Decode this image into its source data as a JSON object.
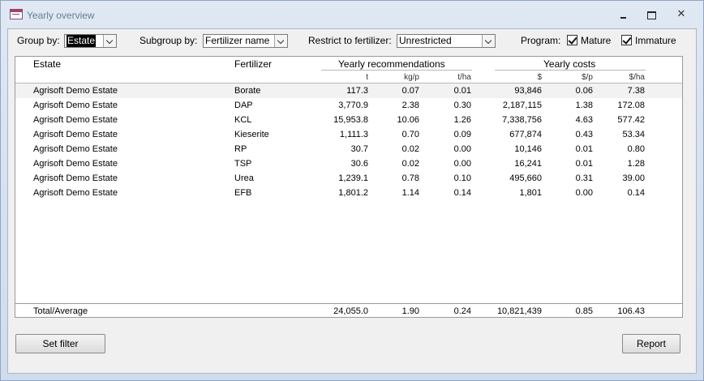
{
  "window": {
    "title": "Yearly overview"
  },
  "filters": {
    "group_by_label": "Group by:",
    "group_by_value": "Estate",
    "subgroup_by_label": "Subgroup by:",
    "subgroup_by_value": "Fertilizer name",
    "restrict_label": "Restrict to fertilizer:",
    "restrict_value": "Unrestricted",
    "program_label": "Program:",
    "mature_label": "Mature",
    "mature_checked": true,
    "immature_label": "Immature",
    "immature_checked": true
  },
  "table": {
    "col_estate": "Estate",
    "col_fertilizer": "Fertilizer",
    "group_recommendations": "Yearly  recommendations",
    "group_costs": "Yearly costs",
    "sub_t": "t",
    "sub_kgp": "kg/p",
    "sub_tha": "t/ha",
    "sub_usd": "$",
    "sub_usdp": "$/p",
    "sub_usdha": "$/ha",
    "rows": [
      {
        "estate": "Agrisoft Demo Estate",
        "fertilizer": "Borate",
        "t": "117.3",
        "kgp": "0.07",
        "tha": "0.01",
        "usd": "93,846",
        "usdp": "0.06",
        "usdha": "7.38"
      },
      {
        "estate": "Agrisoft Demo Estate",
        "fertilizer": "DAP",
        "t": "3,770.9",
        "kgp": "2.38",
        "tha": "0.30",
        "usd": "2,187,115",
        "usdp": "1.38",
        "usdha": "172.08"
      },
      {
        "estate": "Agrisoft Demo Estate",
        "fertilizer": "KCL",
        "t": "15,953.8",
        "kgp": "10.06",
        "tha": "1.26",
        "usd": "7,338,756",
        "usdp": "4.63",
        "usdha": "577.42"
      },
      {
        "estate": "Agrisoft Demo Estate",
        "fertilizer": "Kieserite",
        "t": "1,111.3",
        "kgp": "0.70",
        "tha": "0.09",
        "usd": "677,874",
        "usdp": "0.43",
        "usdha": "53.34"
      },
      {
        "estate": "Agrisoft Demo Estate",
        "fertilizer": "RP",
        "t": "30.7",
        "kgp": "0.02",
        "tha": "0.00",
        "usd": "10,146",
        "usdp": "0.01",
        "usdha": "0.80"
      },
      {
        "estate": "Agrisoft Demo Estate",
        "fertilizer": "TSP",
        "t": "30.6",
        "kgp": "0.02",
        "tha": "0.00",
        "usd": "16,241",
        "usdp": "0.01",
        "usdha": "1.28"
      },
      {
        "estate": "Agrisoft Demo Estate",
        "fertilizer": "Urea",
        "t": "1,239.1",
        "kgp": "0.78",
        "tha": "0.10",
        "usd": "495,660",
        "usdp": "0.31",
        "usdha": "39.00"
      },
      {
        "estate": "Agrisoft Demo Estate",
        "fertilizer": "EFB",
        "t": "1,801.2",
        "kgp": "1.14",
        "tha": "0.14",
        "usd": "1,801",
        "usdp": "0.00",
        "usdha": "0.14"
      }
    ],
    "total": {
      "label": "Total/Average",
      "t": "24,055.0",
      "kgp": "1.90",
      "tha": "0.24",
      "usd": "10,821,439",
      "usdp": "0.85",
      "usdha": "106.43"
    }
  },
  "buttons": {
    "set_filter": "Set filter",
    "report": "Report"
  }
}
